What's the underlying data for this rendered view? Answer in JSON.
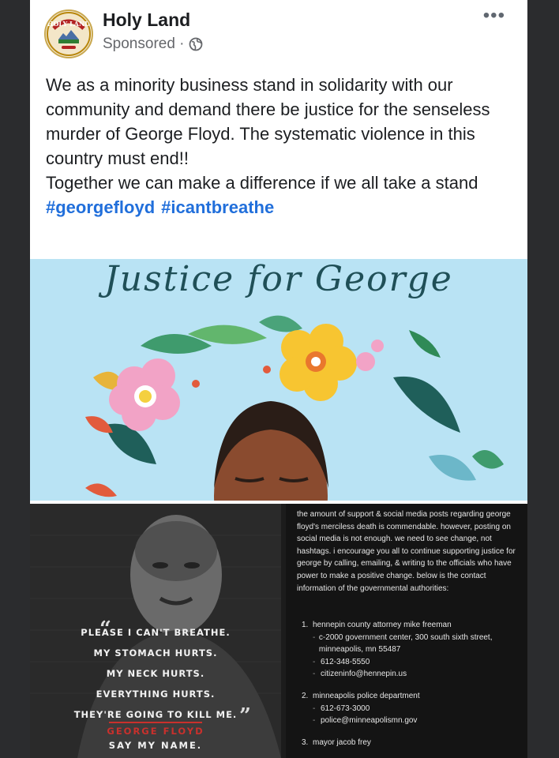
{
  "post": {
    "page_name": "Holy Land",
    "sponsored_label": "Sponsored ·",
    "avatar_text": "HOLY LAND",
    "body_lines": [
      "We as a minority business stand in solidarity with our community and demand there be justice for the senseless murder of George Floyd. The systematic violence in this country must end!!",
      "Together we can make a difference if we all take a stand"
    ],
    "hashtags": [
      "#georgefloyd",
      "#icantbreathe"
    ]
  },
  "art": {
    "title": "Justice for George"
  },
  "quote": {
    "lines": [
      "PLEASE I CAN'T BREATHE.",
      "MY STOMACH HURTS.",
      "MY NECK HURTS.",
      "EVERYTHING HURTS.",
      "THEY'RE GOING TO KILL ME."
    ],
    "author": "GEORGE FLOYD",
    "tagline": "SAY MY NAME."
  },
  "info": {
    "intro": "the amount of support & social media posts regarding george floyd's merciless death is commendable. however, posting on social media is not enough. we need to see change, not hashtags. i encourage you all to continue supporting justice for george by calling, emailing, & writing to the officials who have power to make a positive change. below is the contact information of the governmental authorities:",
    "contacts": [
      {
        "number": "1.",
        "title": "hennepin county attorney mike freeman",
        "details": [
          "c-2000 government center, 300 south sixth street, minneapolis, mn 55487",
          "612-348-5550",
          "citizeninfo@hennepin.us"
        ]
      },
      {
        "number": "2.",
        "title": "minneapolis police department",
        "details": [
          "612-673-3000",
          "police@minneapolismn.gov"
        ]
      },
      {
        "number": "3.",
        "title": "mayor jacob frey",
        "details": []
      }
    ]
  },
  "colors": {
    "hashtag": "#216fdb",
    "art_background": "#b9e3f4",
    "signature_red": "#c9302c"
  },
  "icons": {
    "privacy": "globe-icon",
    "menu": "more-options-icon"
  }
}
